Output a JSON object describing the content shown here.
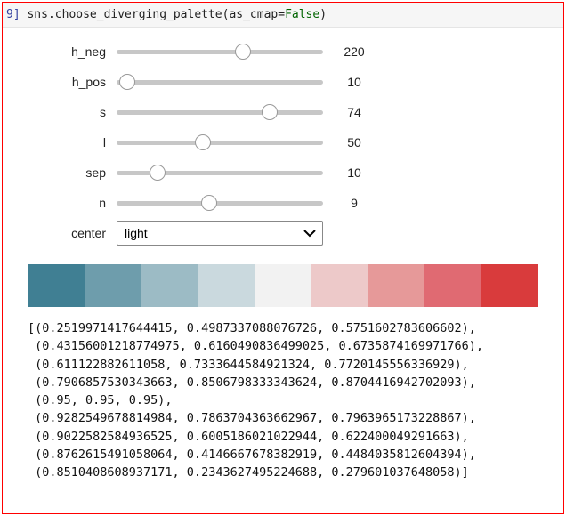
{
  "cell": {
    "prompt": "9]",
    "code_prefix": " sns.choose_diverging_palette(as_cmap=",
    "code_value": "False",
    "code_suffix": ")"
  },
  "sliders": [
    {
      "name": "h_neg",
      "value": 220,
      "pos_pct": 61
    },
    {
      "name": "h_pos",
      "value": 10,
      "pos_pct": 5
    },
    {
      "name": "s",
      "value": 74,
      "pos_pct": 74
    },
    {
      "name": "l",
      "value": 50,
      "pos_pct": 42
    },
    {
      "name": "sep",
      "value": 10,
      "pos_pct": 20
    },
    {
      "name": "n",
      "value": 9,
      "pos_pct": 45
    }
  ],
  "select": {
    "label": "center",
    "value": "light"
  },
  "palette_colors": [
    "#407f93",
    "#6e9dac",
    "#9cbbc5",
    "#cad9de",
    "#f2f2f2",
    "#edc9c9",
    "#e69999",
    "#e06a72",
    "#d93b3c"
  ],
  "output_tuples": [
    [
      0.2519971417644415,
      0.4987337088076726,
      0.5751602783606602
    ],
    [
      0.43156001218774975,
      0.6160490836499025,
      0.6735874169971766
    ],
    [
      0.611122882611058,
      0.7333644584921324,
      0.7720145556336929
    ],
    [
      0.7906857530343663,
      0.8506798333343624,
      0.8704416942702093
    ],
    [
      0.95,
      0.95,
      0.95
    ],
    [
      0.9282549678814984,
      0.7863704363662967,
      0.7963965173228867
    ],
    [
      0.9022582584936525,
      0.6005186021022944,
      0.622400049291663
    ],
    [
      0.8762615491058064,
      0.4146667678382919,
      0.4484035812604394
    ],
    [
      0.8510408608937171,
      0.2343627495224688,
      0.279601037648058
    ]
  ]
}
